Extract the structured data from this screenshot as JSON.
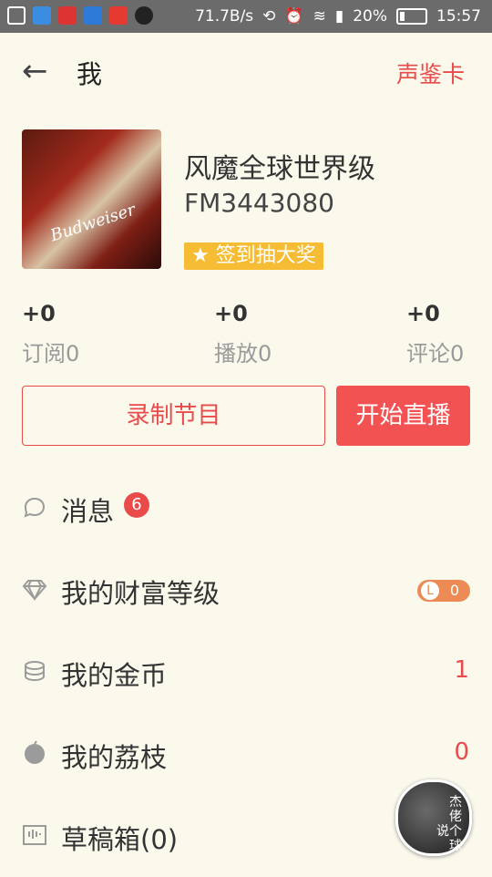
{
  "status_bar": {
    "speed": "71.7B/s",
    "battery": "20%",
    "time": "15:57"
  },
  "header": {
    "title": "我",
    "right_action": "声鉴卡"
  },
  "profile": {
    "avatar_text": "Budweiser",
    "name": "风魔全球世界级",
    "fm_id": "FM3443080",
    "checkin_label": "★ 签到抽大奖"
  },
  "stats": [
    {
      "delta": "+0",
      "label": "订阅0"
    },
    {
      "delta": "+0",
      "label": "播放0"
    },
    {
      "delta": "+0",
      "label": "评论0"
    }
  ],
  "actions": {
    "record": "录制节目",
    "live": "开始直播"
  },
  "menu": {
    "messages": {
      "label": "消息",
      "badge": "6"
    },
    "wealth": {
      "label": "我的财富等级",
      "level_letter": "L",
      "level_value": "0"
    },
    "coins": {
      "label": "我的金币",
      "value": "1"
    },
    "lychee": {
      "label": "我的荔枝",
      "value": "0"
    },
    "drafts": {
      "label": "草稿箱(0)"
    }
  },
  "floating_avatar": {
    "text_line1": "杰",
    "text_line2": "佬",
    "text_line3": "说个",
    "text_line4": "球"
  }
}
